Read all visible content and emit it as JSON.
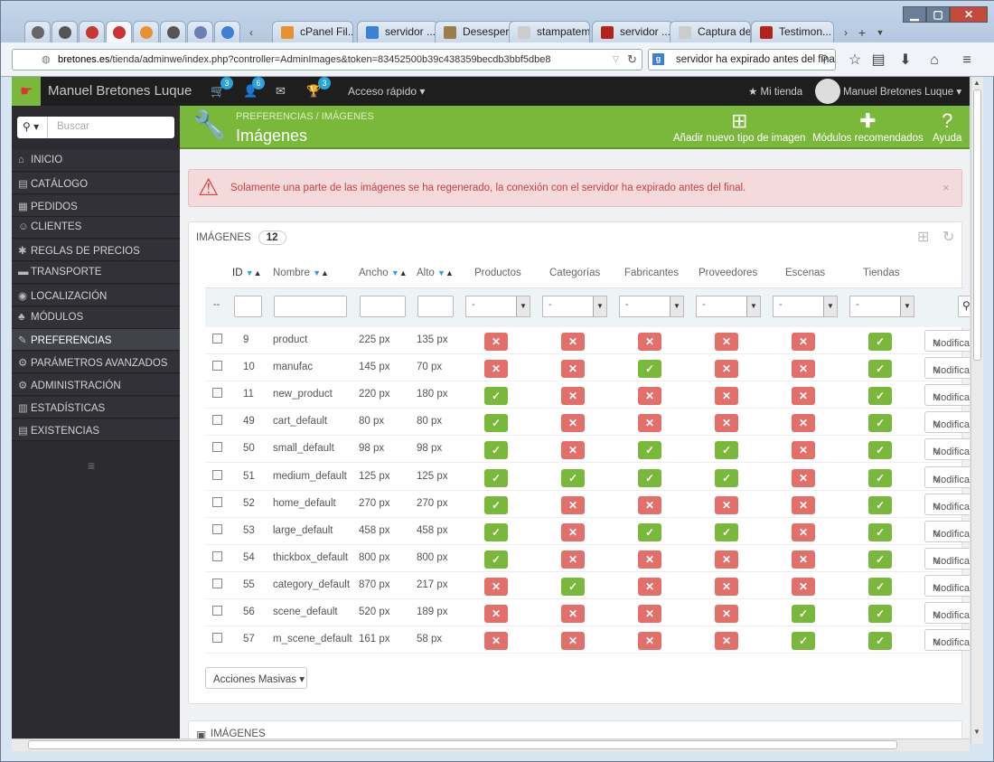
{
  "browser": {
    "tabs": [
      {
        "label": "cPanel Fil...",
        "color": "#e8912f"
      },
      {
        "label": "servidor ...",
        "color": "#3f7fd6"
      },
      {
        "label": "Desesper...",
        "color": "#9b7d4c"
      },
      {
        "label": "stampatemal...",
        "color": "#cccccc"
      },
      {
        "label": "servidor ...",
        "color": "#b3231b"
      },
      {
        "label": "Captura de P...",
        "color": "#cccccc"
      },
      {
        "label": "Testimon...",
        "color": "#b3231b"
      }
    ],
    "url_host": "bretones.es",
    "url_path": "/tienda/adminwe/index.php?controller=AdminImages&token=83452500b39c438359becdb3bbf5dbe8",
    "search_text": "servidor ha expirado antes del final"
  },
  "topbar": {
    "shop_name": "Manuel Bretones Luque",
    "cart_badge": "3",
    "customers_badge": "6",
    "trophy_badge": "3",
    "quick_access": "Acceso rápido",
    "my_shop": "Mi tienda",
    "user": "Manuel Bretones Luque"
  },
  "sidebar": {
    "search_placeholder": "Buscar",
    "items": [
      {
        "label": "INICIO",
        "icon": "⌂"
      },
      {
        "label": "CATÁLOGO",
        "icon": "▤"
      },
      {
        "label": "PEDIDOS",
        "icon": "▦"
      },
      {
        "label": "CLIENTES",
        "icon": "☺"
      },
      {
        "label": "REGLAS DE PRECIOS",
        "icon": "✱"
      },
      {
        "label": "TRANSPORTE",
        "icon": "▬"
      },
      {
        "label": "LOCALIZACIÓN",
        "icon": "◉"
      },
      {
        "label": "MÓDULOS",
        "icon": "♣"
      },
      {
        "label": "PREFERENCIAS",
        "icon": "✎"
      },
      {
        "label": "PARÁMETROS AVANZADOS",
        "icon": "⚙"
      },
      {
        "label": "ADMINISTRACIÓN",
        "icon": "⚙"
      },
      {
        "label": "ESTADÍSTICAS",
        "icon": "▥"
      },
      {
        "label": "EXISTENCIAS",
        "icon": "▤"
      }
    ]
  },
  "header": {
    "breadcrumb": "PREFERENCIAS  /  IMÁGENES",
    "title": "Imágenes",
    "btn_add": "Añadir nuevo tipo de imagen",
    "btn_modules": "Módulos recomendados",
    "btn_help": "Ayuda"
  },
  "alert": "Solamente una parte de las imágenes se ha regenerado, la conexión con el servidor ha expirado antes del final.",
  "panel": {
    "title": "IMÁGENES",
    "count": "12",
    "columns": [
      "ID",
      "Nombre",
      "Ancho",
      "Alto",
      "Productos",
      "Categorías",
      "Fabricantes",
      "Proveedores",
      "Escenas",
      "Tiendas"
    ],
    "filter_dash": "--",
    "select_value": "-",
    "edit_label": "Modificar",
    "bulk_label": "Acciones Masivas"
  },
  "rows": [
    {
      "id": "9",
      "name": "product",
      "w": "225 px",
      "h": "135 px",
      "flags": [
        0,
        0,
        0,
        0,
        0,
        1
      ]
    },
    {
      "id": "10",
      "name": "manufac",
      "w": "145 px",
      "h": "70 px",
      "flags": [
        0,
        0,
        1,
        0,
        0,
        1
      ]
    },
    {
      "id": "11",
      "name": "new_product",
      "w": "220 px",
      "h": "180 px",
      "flags": [
        1,
        0,
        0,
        0,
        0,
        1
      ]
    },
    {
      "id": "49",
      "name": "cart_default",
      "w": "80 px",
      "h": "80 px",
      "flags": [
        1,
        0,
        0,
        0,
        0,
        1
      ]
    },
    {
      "id": "50",
      "name": "small_default",
      "w": "98 px",
      "h": "98 px",
      "flags": [
        1,
        0,
        1,
        1,
        0,
        1
      ]
    },
    {
      "id": "51",
      "name": "medium_default",
      "w": "125 px",
      "h": "125 px",
      "flags": [
        1,
        1,
        1,
        1,
        0,
        1
      ]
    },
    {
      "id": "52",
      "name": "home_default",
      "w": "270 px",
      "h": "270 px",
      "flags": [
        1,
        0,
        0,
        0,
        0,
        1
      ]
    },
    {
      "id": "53",
      "name": "large_default",
      "w": "458 px",
      "h": "458 px",
      "flags": [
        1,
        0,
        1,
        1,
        0,
        1
      ]
    },
    {
      "id": "54",
      "name": "thickbox_default",
      "w": "800 px",
      "h": "800 px",
      "flags": [
        1,
        0,
        0,
        0,
        0,
        1
      ]
    },
    {
      "id": "55",
      "name": "category_default",
      "w": "870 px",
      "h": "217 px",
      "flags": [
        0,
        1,
        0,
        0,
        0,
        1
      ]
    },
    {
      "id": "56",
      "name": "scene_default",
      "w": "520 px",
      "h": "189 px",
      "flags": [
        0,
        0,
        0,
        0,
        1,
        1
      ]
    },
    {
      "id": "57",
      "name": "m_scene_default",
      "w": "161 px",
      "h": "58 px",
      "flags": [
        0,
        0,
        0,
        0,
        1,
        1
      ]
    }
  ],
  "panel2_title": "IMÁGENES",
  "colors": {
    "green": "#79b83a",
    "red": "#e36f6a",
    "blue": "#2aa3dc"
  }
}
